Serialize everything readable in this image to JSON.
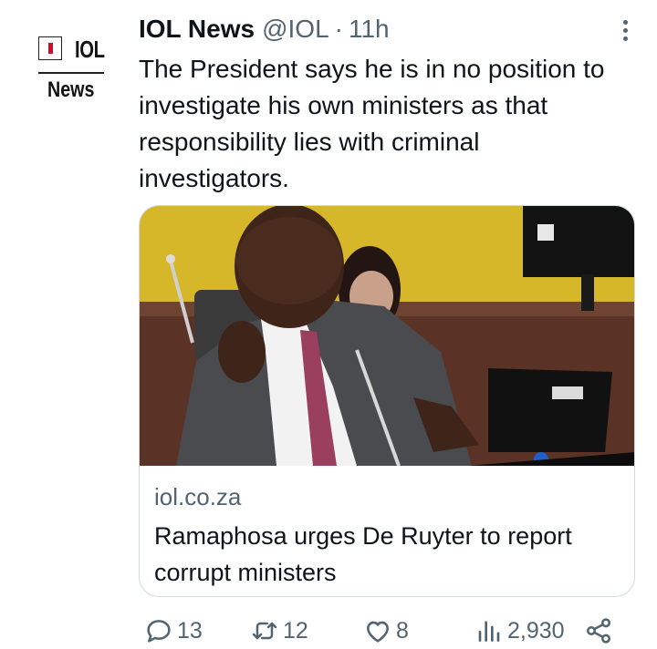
{
  "avatar": {
    "logo_text": "IOL",
    "logo_sub": "News"
  },
  "tweet": {
    "name": "IOL News",
    "handle": "@IOL",
    "separator": "·",
    "time": "11h",
    "text": "The President says he is in no position to investigate his own ministers as that responsibility lies with criminal investigators."
  },
  "card": {
    "domain": "iol.co.za",
    "title": "Ramaphosa urges De Ruyter to report corrupt ministers"
  },
  "actions": {
    "replies": "13",
    "retweets": "12",
    "likes": "8",
    "views": "2,930"
  },
  "colors": {
    "text_primary": "#0f1419",
    "text_secondary": "#536471",
    "border": "#cfd9de",
    "logo_red": "#c8102e"
  },
  "icons": [
    "more-icon",
    "reply-icon",
    "retweet-icon",
    "like-icon",
    "views-icon",
    "share-icon"
  ]
}
